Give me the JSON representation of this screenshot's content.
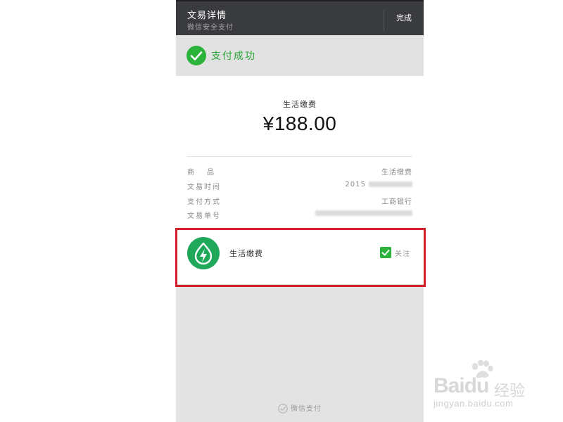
{
  "header": {
    "title": "文易详情",
    "subtitle": "微信安全支付",
    "done_label": "完成"
  },
  "status": {
    "text": "支付成功",
    "icon": "check-circle-icon",
    "color": "#2bb33b"
  },
  "payment": {
    "item_title": "生活缴费",
    "amount": "¥188.00"
  },
  "details": [
    {
      "label": "商品",
      "value": "生活缴费"
    },
    {
      "label": "文易时间",
      "value": "2015"
    },
    {
      "label": "支付方式",
      "value": "工商银行"
    },
    {
      "label": "文易单号",
      "value": ""
    }
  ],
  "service": {
    "name": "生活缴费",
    "follow_label": "关注",
    "follow_checked": true,
    "logo_icon": "lightning-drop-icon",
    "logo_color": "#1fa85a"
  },
  "footer": {
    "label": "微信支付",
    "icon": "wechat-pay-icon"
  },
  "highlight_color": "#d12027",
  "watermark": {
    "brand": "Baidu",
    "cn": "经验",
    "url": "jingyan.baidu.com"
  }
}
